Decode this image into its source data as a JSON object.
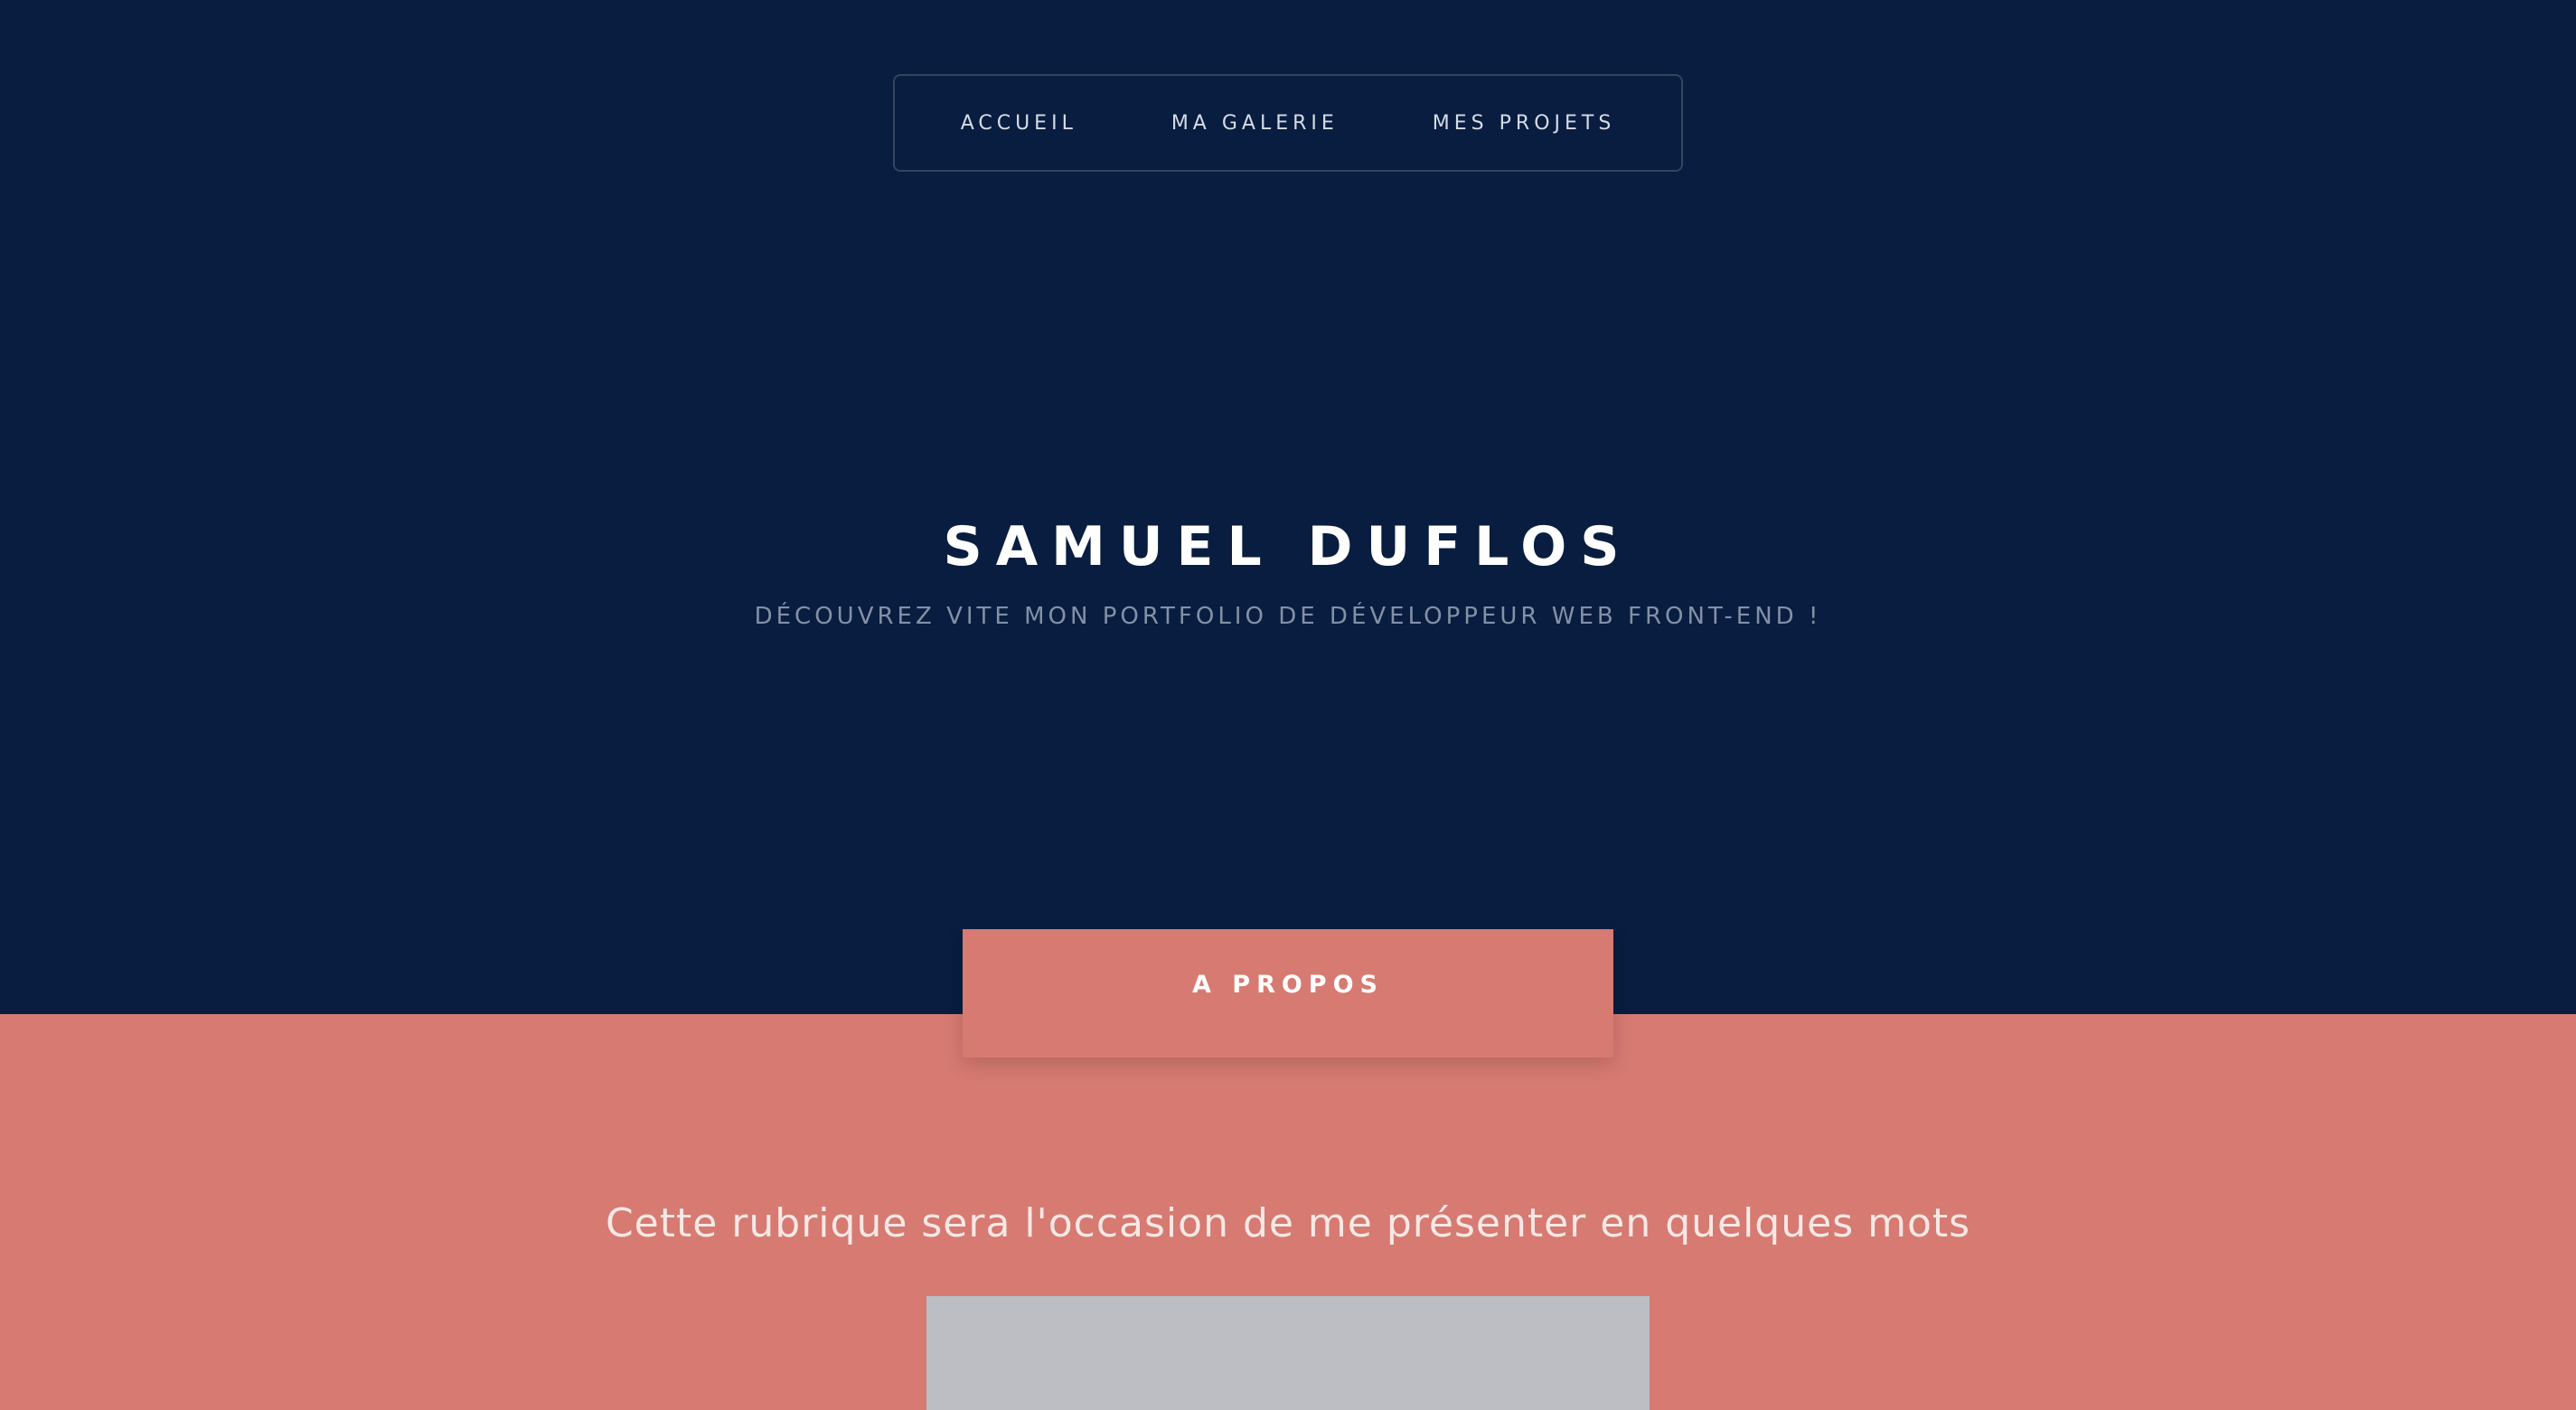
{
  "nav": {
    "items": [
      {
        "label": "ACCUEIL"
      },
      {
        "label": "MA GALERIE"
      },
      {
        "label": "MES PROJETS"
      }
    ]
  },
  "hero": {
    "title": "SAMUEL DUFLOS",
    "subtitle": "DÉCOUVREZ VITE MON PORTFOLIO DE DÉVELOPPEUR WEB FRONT-END !"
  },
  "about": {
    "tab_label": "A PROPOS",
    "subtitle": "Cette rubrique sera l'occasion de me présenter en quelques mots"
  },
  "colors": {
    "hero_background": "#081d3f",
    "about_background": "#d67a72",
    "placeholder": "#bdbec3"
  }
}
